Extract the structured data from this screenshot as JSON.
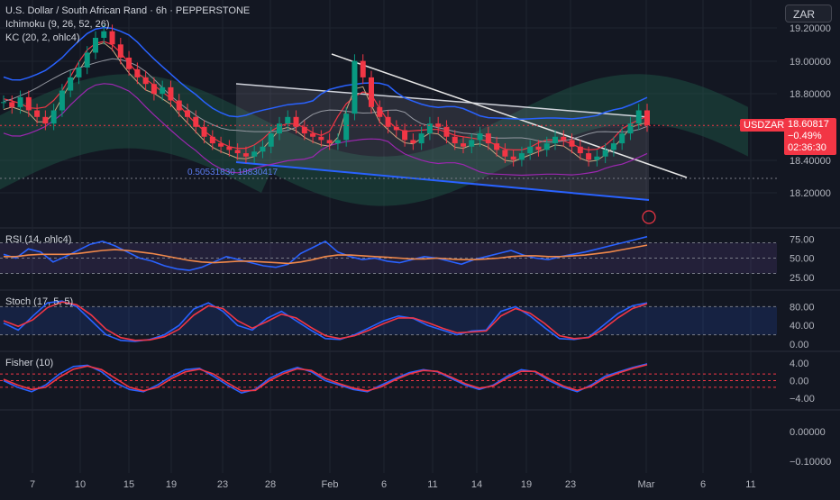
{
  "header": {
    "title": "U.S. Dollar / South African Rand · 6h · PEPPERSTONE",
    "indicator1": "Ichimoku (9, 26, 52, 26)",
    "indicator2": "KC (20, 2, ohlc4)"
  },
  "currency_button": "ZAR",
  "last_price": {
    "symbol": "USDZAR",
    "price": "18.60817",
    "change": "−0.49%",
    "countdown": "02:36:30"
  },
  "fib_label": "0.50531830 18830417",
  "panes": {
    "rsi_label": "RSI (14, ohlc4)",
    "stoch_label": "Stoch (17, 5, 5)",
    "fisher_label": "Fisher (10)"
  },
  "x_axis_labels": [
    "7",
    "10",
    "15",
    "19",
    "23",
    "28",
    "Feb",
    "6",
    "11",
    "14",
    "19",
    "23",
    "Mar",
    "6",
    "11"
  ],
  "colors": {
    "background": "#131722",
    "grid": "#1f2430",
    "up": "#089981",
    "down": "#f23645",
    "rsi": "#2962ff",
    "rsi_ma": "#f0884a",
    "accent_price": "#f23645"
  },
  "chart_data": [
    {
      "type": "candlestick",
      "title": "U.S. Dollar / South African Rand · 6h · PEPPERSTONE",
      "y_ticks": [
        "19.20000",
        "19.00000",
        "18.80000",
        "18.60000",
        "18.40000",
        "18.20000"
      ],
      "ylim": [
        18.12,
        19.25
      ],
      "x_ticks": [
        "7",
        "10",
        "15",
        "19",
        "23",
        "28",
        "Feb",
        "6",
        "11",
        "14",
        "19",
        "23",
        "Mar",
        "6",
        "11"
      ],
      "closes": [
        18.75,
        18.72,
        18.78,
        18.7,
        18.66,
        18.62,
        18.7,
        18.82,
        18.9,
        18.96,
        19.05,
        19.14,
        19.18,
        19.1,
        19.02,
        18.95,
        18.9,
        18.86,
        18.8,
        18.84,
        18.76,
        18.7,
        18.66,
        18.6,
        18.54,
        18.5,
        18.48,
        18.46,
        18.44,
        18.42,
        18.45,
        18.48,
        18.56,
        18.62,
        18.66,
        18.6,
        18.56,
        18.54,
        18.52,
        18.5,
        18.52,
        18.68,
        19.0,
        18.9,
        18.72,
        18.66,
        18.6,
        18.58,
        18.52,
        18.5,
        18.56,
        18.62,
        18.6,
        18.54,
        18.5,
        18.48,
        18.52,
        18.56,
        18.5,
        18.46,
        18.42,
        18.4,
        18.44,
        18.48,
        18.46,
        18.5,
        18.54,
        18.52,
        18.48,
        18.44,
        18.4,
        18.42,
        18.46,
        18.5,
        18.56,
        18.62,
        18.7,
        18.61
      ],
      "last": 18.60817,
      "grid": true
    },
    {
      "type": "line",
      "title": "RSI (14, ohlc4)",
      "y_ticks": [
        "75.00",
        "50.00",
        "25.00"
      ],
      "ylim": [
        20,
        80
      ],
      "series": [
        {
          "name": "RSI",
          "values": [
            55,
            50,
            62,
            58,
            45,
            52,
            60,
            68,
            72,
            66,
            58,
            50,
            46,
            40,
            36,
            34,
            38,
            45,
            52,
            48,
            44,
            40,
            38,
            42,
            56,
            64,
            72,
            58,
            52,
            48,
            50,
            46,
            44,
            48,
            52,
            50,
            46,
            42,
            48,
            52,
            56,
            60,
            54,
            50,
            48,
            52,
            55,
            58,
            62,
            66,
            70,
            74,
            78
          ]
        },
        {
          "name": "MA",
          "values": [
            52,
            52,
            54,
            55,
            55,
            55,
            56,
            58,
            60,
            61,
            60,
            58,
            56,
            53,
            50,
            47,
            45,
            44,
            45,
            46,
            46,
            45,
            44,
            43,
            45,
            48,
            52,
            54,
            54,
            53,
            52,
            51,
            50,
            49,
            49,
            50,
            49,
            48,
            48,
            49,
            50,
            52,
            53,
            53,
            52,
            52,
            53,
            54,
            56,
            58,
            61,
            64,
            67
          ]
        }
      ]
    },
    {
      "type": "line",
      "title": "Stoch (17, 5, 5)",
      "y_ticks": [
        "80.00",
        "40.00",
        "0.00"
      ],
      "ylim": [
        0,
        100
      ],
      "series": [
        {
          "name": "%K",
          "values": [
            45,
            30,
            60,
            88,
            92,
            80,
            50,
            20,
            8,
            6,
            10,
            20,
            40,
            75,
            88,
            70,
            40,
            30,
            55,
            70,
            50,
            30,
            12,
            10,
            20,
            35,
            50,
            60,
            55,
            40,
            30,
            20,
            28,
            30,
            70,
            80,
            60,
            35,
            12,
            10,
            15,
            40,
            65,
            82,
            88
          ]
        },
        {
          "name": "%D",
          "values": [
            50,
            38,
            52,
            78,
            90,
            84,
            62,
            32,
            14,
            8,
            9,
            16,
            32,
            62,
            82,
            76,
            50,
            34,
            48,
            64,
            56,
            36,
            18,
            12,
            18,
            30,
            44,
            56,
            56,
            46,
            34,
            24,
            26,
            28,
            60,
            76,
            66,
            44,
            18,
            12,
            14,
            32,
            56,
            76,
            86
          ]
        }
      ]
    },
    {
      "type": "line",
      "title": "Fisher (10)",
      "y_ticks": [
        "4.00",
        "0.00",
        "−4.00"
      ],
      "ylim": [
        -5,
        5
      ],
      "series": [
        {
          "name": "Fisher",
          "values": [
            0,
            -1.5,
            -2.5,
            -1,
            1.5,
            3.2,
            3.5,
            2,
            -0.5,
            -2,
            -2.5,
            -1,
            1,
            2.5,
            2.8,
            1,
            -1,
            -2.8,
            -2,
            0.5,
            2,
            3,
            2,
            0,
            -1,
            -2,
            -2.5,
            -1,
            0.5,
            1.8,
            2.5,
            2,
            0.5,
            -1,
            -2,
            -1,
            1,
            2.5,
            2,
            0,
            -1.5,
            -2.5,
            -1,
            1,
            2,
            3,
            3.8
          ]
        },
        {
          "name": "Trigger",
          "values": [
            0.3,
            -1,
            -2,
            -1.5,
            0.8,
            2.6,
            3.3,
            2.5,
            0.5,
            -1.5,
            -2.3,
            -1.5,
            0.5,
            2,
            2.6,
            1.5,
            -0.5,
            -2.3,
            -2.2,
            0,
            1.6,
            2.7,
            2.3,
            0.5,
            -0.7,
            -1.7,
            -2.3,
            -1.4,
            0.2,
            1.5,
            2.3,
            2.1,
            0.8,
            -0.7,
            -1.7,
            -1.2,
            0.6,
            2.1,
            2.1,
            0.4,
            -1.2,
            -2.2,
            -1.3,
            0.6,
            1.8,
            2.8,
            3.6
          ]
        }
      ]
    },
    {
      "type": "line",
      "title": "",
      "y_ticks": [
        "0.00000",
        "−0.10000"
      ],
      "ylim": [
        -0.15,
        0.05
      ],
      "series": []
    }
  ]
}
